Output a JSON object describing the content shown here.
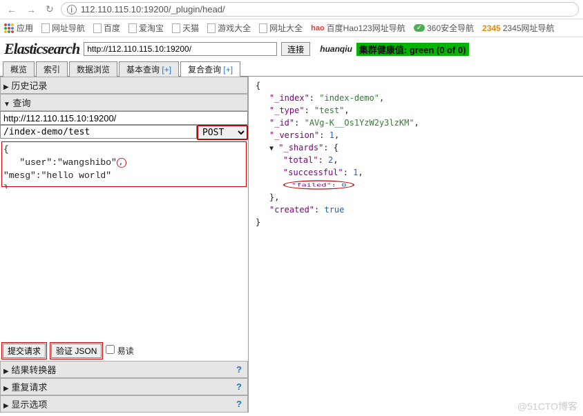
{
  "browser": {
    "url": "112.110.115.10:19200/_plugin/head/",
    "apps": "应用",
    "bookmarks": [
      "网址导航",
      "百度",
      "爱淘宝",
      "天猫",
      "游戏大全",
      "网址大全"
    ],
    "bookmarks2": [
      {
        "label": "百度Hao123网址导航",
        "prefix": "hao"
      },
      {
        "label": "360安全导航",
        "prefix": "pill"
      },
      {
        "label": "2345网址导航",
        "prefix": "num"
      }
    ]
  },
  "app": {
    "name": "Elasticsearch",
    "server_url": "http://112.110.115.10:19200/",
    "connect": "连接",
    "user": "huanqiu",
    "health": "集群健康值: green (0 of 0)",
    "tabs": [
      {
        "label": "概览"
      },
      {
        "label": "索引"
      },
      {
        "label": "数据浏览"
      },
      {
        "label": "基本查询 ",
        "plus": "[+]"
      },
      {
        "label": "复合查询 ",
        "plus": "[+]",
        "active": true
      }
    ]
  },
  "left": {
    "history": "历史记录",
    "query": "查询",
    "server": "http://112.110.115.10:19200/",
    "path": "/index-demo/test",
    "method": "POST",
    "body_line1": "{",
    "body_line2": "   \"user\":\"wangshibo\",",
    "body_line3": "   \"mesg\":\"hello world\"",
    "body_line4": "}",
    "submit": "提交请求",
    "validate": "验证 JSON",
    "pretty": "易读",
    "sections": [
      "结果转换器",
      "重复请求",
      "显示选项"
    ]
  },
  "response": {
    "_index": "index-demo",
    "_type": "test",
    "_id": "AVg-K__Os1YzW2y3lzKM",
    "_version": 1,
    "_shards": {
      "total": 2,
      "successful": 1,
      "failed": 0
    },
    "created": true
  },
  "watermark": "@51CTO博客"
}
